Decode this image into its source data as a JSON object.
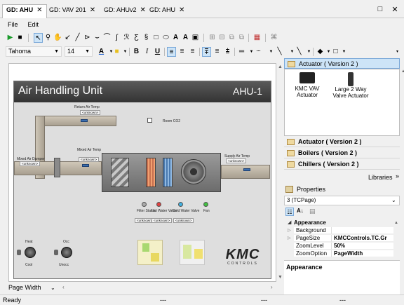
{
  "tabs": [
    {
      "label": "GD: AHU",
      "active": true
    },
    {
      "label": "GD: VAV 201",
      "active": false
    },
    {
      "label": "GD: AHUv2",
      "active": false
    },
    {
      "label": "GD: AHU",
      "active": false
    }
  ],
  "menu": [
    "File",
    "Edit"
  ],
  "toolbar2": {
    "font": "Tahoma",
    "size": "14"
  },
  "drawing": {
    "title": "Air Handling Unit",
    "unit_id": "AHU-1",
    "return_air_temp": "Return Air Temp",
    "room_co2": "Room CO2",
    "mixed_air_temp": "Mixed Air Temp",
    "mixed_air_damper": "Mixed Air Damper",
    "supply_air_temp": "Supply Air Temp",
    "unknown": "<unknown>",
    "filter_status": "Filter Status",
    "hot_water_valve": "Hot Water Valve",
    "cold_water_valve": "Cold Water Valve",
    "fan": "Fan",
    "heat": "Heat",
    "cool": "Cool",
    "occ": "Occ",
    "unocc": "Unocc",
    "logo": "KMC",
    "logo_sub": "CONTROLS"
  },
  "bottom": {
    "page_width": "Page Width"
  },
  "status": {
    "ready": "Ready",
    "seg1": "---",
    "seg2": "---",
    "seg3": "---"
  },
  "right": {
    "top_section": "Actuator ( Version 2 )",
    "gallery": [
      {
        "label": "KMC VAV Actuator",
        "icon": "vav-actuator-icon"
      },
      {
        "label": "Large 2 Way Valve Actuator",
        "icon": "valve-actuator-icon"
      }
    ],
    "sections": [
      "Actuator ( Version 2 )",
      "Boilers ( Version 2 )",
      "Chillers ( Version 2 )"
    ],
    "libraries": "Libraries",
    "properties_title": "Properties",
    "object": "3 (TCPage)",
    "appearance_group": "Appearance",
    "properties": [
      {
        "name": "Background",
        "value": ""
      },
      {
        "name": "PageSize",
        "value": "KMCControls.TC.Gr"
      },
      {
        "name": "ZoomLevel",
        "value": "50%"
      },
      {
        "name": "ZoomOption",
        "value": "PageWidth"
      }
    ],
    "description_title": "Appearance"
  }
}
